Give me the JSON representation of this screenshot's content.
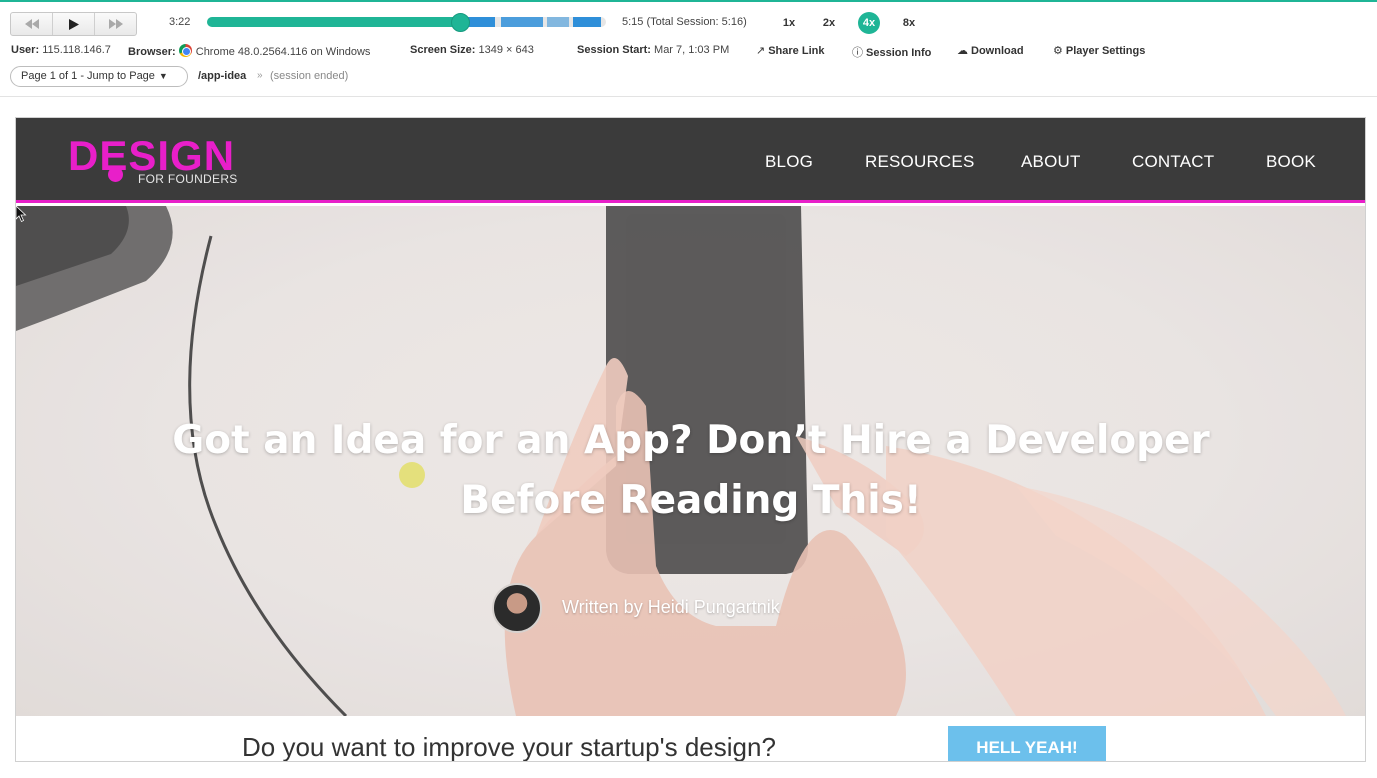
{
  "player": {
    "current_time": "3:22",
    "total_time": "5:15 (Total Session: 5:16)",
    "progress_fraction": 0.64,
    "speeds": [
      "1x",
      "2x",
      "4x",
      "8x"
    ],
    "active_speed": "4x",
    "accent_color": "#1fb596"
  },
  "meta": {
    "user_label": "User:",
    "user_value": "115.118.146.7",
    "browser_label": "Browser:",
    "browser_value": "Chrome 48.0.2564.116 on Windows",
    "screen_label": "Screen Size:",
    "screen_value": "1349 × 643",
    "session_label": "Session Start:",
    "session_value": "Mar 7, 1:03 PM",
    "share_link": "Share Link",
    "session_info": "Session Info",
    "download": "Download",
    "player_settings": "Player Settings"
  },
  "pages": {
    "selector_label": "Page 1 of 1 - Jump to Page",
    "path": "/app-idea",
    "separator": "»",
    "status": "(session ended)"
  },
  "site": {
    "logo_main": "DESIGN",
    "logo_sub": "FOR FOUNDERS",
    "brand_color": "#e81fc9",
    "nav": [
      "BLOG",
      "RESOURCES",
      "ABOUT",
      "CONTACT",
      "BOOK"
    ],
    "hero_title": "Got an Idea for an App? Don’t Hire a Developer Before Reading This!",
    "author": "Written by Heidi Pungartnik",
    "cta_text": "Do you want to improve your startup's design?",
    "cta_button": "HELL YEAH!"
  }
}
